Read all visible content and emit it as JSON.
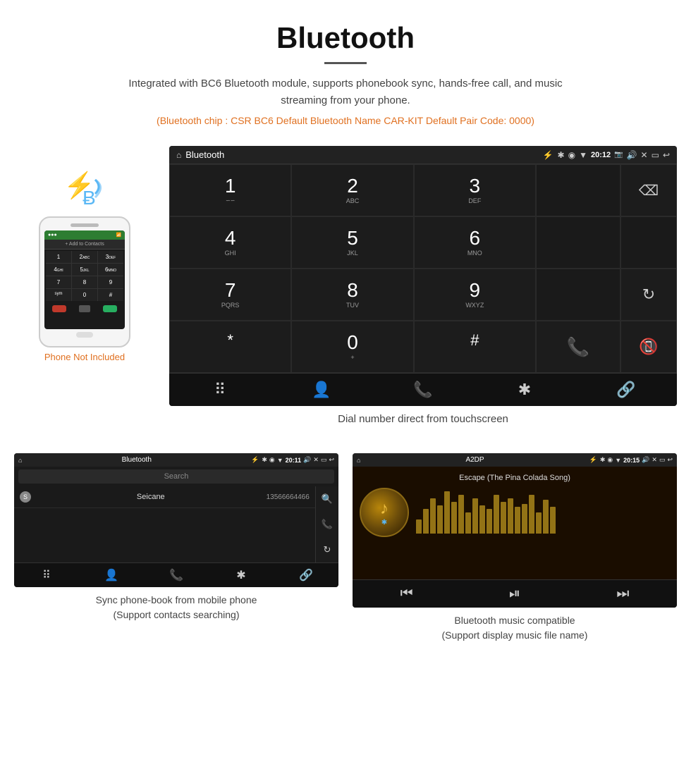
{
  "header": {
    "title": "Bluetooth",
    "subtitle": "Integrated with BC6 Bluetooth module, supports phonebook sync, hands-free call, and music streaming from your phone.",
    "specs": "(Bluetooth chip : CSR BC6    Default Bluetooth Name CAR-KIT    Default Pair Code: 0000)",
    "divider_shown": true
  },
  "phone_area": {
    "not_included_label": "Phone Not Included"
  },
  "main_screen": {
    "status_bar": {
      "home_icon": "⌂",
      "title": "Bluetooth",
      "usb_icon": "⚡",
      "bt_icon": "✱",
      "location_icon": "◉",
      "signal_icon": "▼",
      "time": "20:12",
      "camera_icon": "📷",
      "volume_icon": "🔊",
      "close_icon": "✕",
      "window_icon": "▭",
      "back_icon": "↩"
    },
    "dialpad": {
      "keys": [
        {
          "num": "1",
          "sub": "∽∽"
        },
        {
          "num": "2",
          "sub": "ABC"
        },
        {
          "num": "3",
          "sub": "DEF"
        },
        {
          "num": "4",
          "sub": "GHI"
        },
        {
          "num": "5",
          "sub": "JKL"
        },
        {
          "num": "6",
          "sub": "MNO"
        },
        {
          "num": "7",
          "sub": "PQRS"
        },
        {
          "num": "8",
          "sub": "TUV"
        },
        {
          "num": "9",
          "sub": "WXYZ"
        },
        {
          "num": "*",
          "sub": ""
        },
        {
          "num": "0",
          "sub": "+"
        },
        {
          "num": "#",
          "sub": ""
        }
      ]
    },
    "bottom_nav": {
      "grid_icon": "⠿",
      "person_icon": "👤",
      "phone_icon": "📞",
      "bt_icon": "✱",
      "link_icon": "🔗"
    }
  },
  "main_caption": "Dial number direct from touchscreen",
  "phonebook_screen": {
    "status_bar": {
      "home_icon": "⌂",
      "title": "Bluetooth",
      "usb_icon": "⚡",
      "bt_icon": "✱",
      "location_icon": "◉",
      "signal_icon": "▼",
      "time": "20:11",
      "volume_icon": "🔊",
      "close_icon": "✕",
      "window_icon": "▭",
      "back_icon": "↩"
    },
    "search_placeholder": "Search",
    "contacts": [
      {
        "letter": "S",
        "name": "Seicane",
        "number": "13566664466"
      }
    ],
    "bottom_nav": {
      "grid_icon": "⠿",
      "person_icon": "👤",
      "phone_icon": "📞",
      "bt_icon": "✱",
      "link_icon": "🔗"
    }
  },
  "phonebook_caption": "Sync phone-book from mobile phone\n(Support contacts searching)",
  "music_screen": {
    "status_bar": {
      "home_icon": "⌂",
      "title": "A2DP",
      "usb_icon": "⚡",
      "bt_icon": "✱",
      "location_icon": "◉",
      "signal_icon": "▼",
      "time": "20:15",
      "volume_icon": "🔊",
      "close_icon": "✕",
      "window_icon": "▭",
      "back_icon": "↩"
    },
    "song_title": "Escape (The Pina Colada Song)",
    "viz_bars": [
      20,
      35,
      50,
      40,
      60,
      45,
      55,
      30,
      50,
      40,
      35,
      55,
      45,
      50,
      38,
      42,
      55,
      30,
      48,
      38
    ],
    "controls": {
      "prev_icon": "⏮",
      "play_pause_icon": "⏯",
      "next_icon": "⏭"
    }
  },
  "music_caption": "Bluetooth music compatible\n(Support display music file name)"
}
